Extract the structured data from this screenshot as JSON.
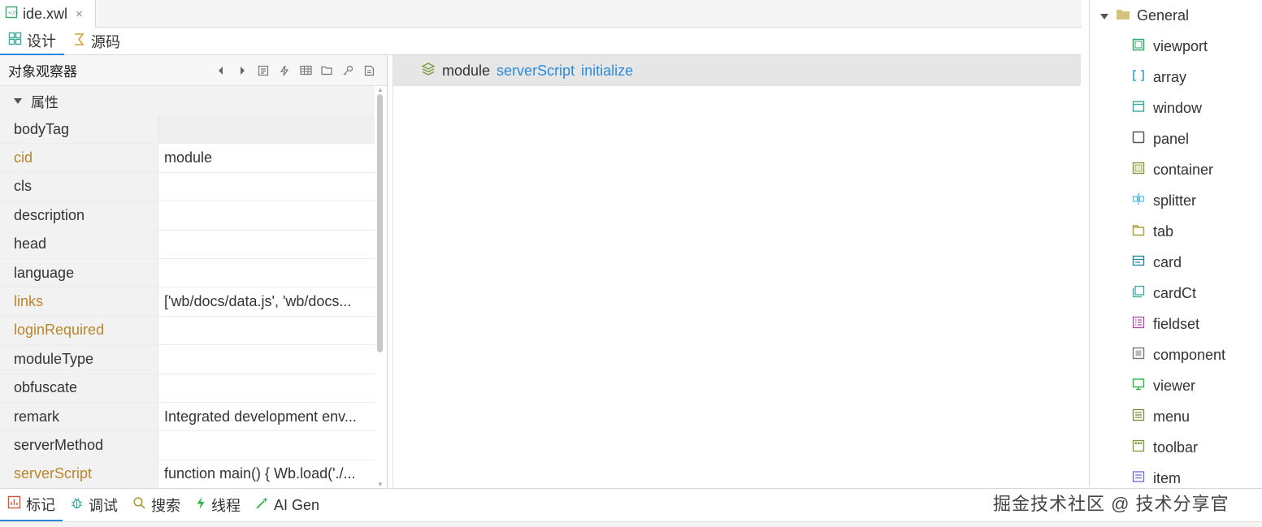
{
  "file_tab": {
    "name": "ide.xwl",
    "close": "×"
  },
  "mode_tabs": [
    {
      "label": "设计",
      "icon": "design-icon"
    },
    {
      "label": "源码",
      "icon": "source-icon"
    }
  ],
  "inspector": {
    "title": "对象观察器",
    "group": "属性",
    "properties": [
      {
        "name": "bodyTag",
        "value": ""
      },
      {
        "name": "cid",
        "value": "module"
      },
      {
        "name": "cls",
        "value": ""
      },
      {
        "name": "description",
        "value": ""
      },
      {
        "name": "head",
        "value": ""
      },
      {
        "name": "language",
        "value": ""
      },
      {
        "name": "links",
        "value": "['wb/docs/data.js', 'wb/docs..."
      },
      {
        "name": "loginRequired",
        "value": ""
      },
      {
        "name": "moduleType",
        "value": ""
      },
      {
        "name": "obfuscate",
        "value": ""
      },
      {
        "name": "remark",
        "value": "Integrated development env..."
      },
      {
        "name": "serverMethod",
        "value": ""
      },
      {
        "name": "serverScript",
        "value": "function main() { Wb.load('./..."
      }
    ]
  },
  "outline": {
    "module": "module",
    "server_script": "serverScript",
    "initialize": "initialize"
  },
  "palette": {
    "group": "General",
    "items": [
      {
        "label": "viewport",
        "icon": "viewport-icon",
        "color": "#3aa76d"
      },
      {
        "label": "array",
        "icon": "array-icon",
        "color": "#2ea4d8"
      },
      {
        "label": "window",
        "icon": "window-icon",
        "color": "#3aa79a"
      },
      {
        "label": "panel",
        "icon": "panel-icon",
        "color": "#555555"
      },
      {
        "label": "container",
        "icon": "container-icon",
        "color": "#8a9a3a"
      },
      {
        "label": "splitter",
        "icon": "splitter-icon",
        "color": "#5bb7e0"
      },
      {
        "label": "tab",
        "icon": "tab-icon",
        "color": "#a7a03a"
      },
      {
        "label": "card",
        "icon": "card-icon",
        "color": "#2a8aa0"
      },
      {
        "label": "cardCt",
        "icon": "card-container-icon",
        "color": "#3aa79a"
      },
      {
        "label": "fieldset",
        "icon": "fieldset-icon",
        "color": "#b04aa8"
      },
      {
        "label": "component",
        "icon": "component-icon",
        "color": "#777777"
      },
      {
        "label": "viewer",
        "icon": "viewer-icon",
        "color": "#2bb24a"
      },
      {
        "label": "menu",
        "icon": "menu-icon",
        "color": "#7a8a3a"
      },
      {
        "label": "toolbar",
        "icon": "toolbar-icon",
        "color": "#7a9a3a"
      },
      {
        "label": "item",
        "icon": "item-icon",
        "color": "#6a6ae0"
      }
    ]
  },
  "bottom_tabs": [
    {
      "label": "标记",
      "icon": "marker-icon"
    },
    {
      "label": "调试",
      "icon": "debug-icon"
    },
    {
      "label": "搜索",
      "icon": "search-icon"
    },
    {
      "label": "线程",
      "icon": "thread-icon"
    },
    {
      "label": "AI Gen",
      "icon": "ai-gen-icon"
    }
  ],
  "watermark": "掘金技术社区 @ 技术分享官",
  "colors": {
    "accent": "#2b8ad8",
    "property_highlight": "#b9852c"
  }
}
